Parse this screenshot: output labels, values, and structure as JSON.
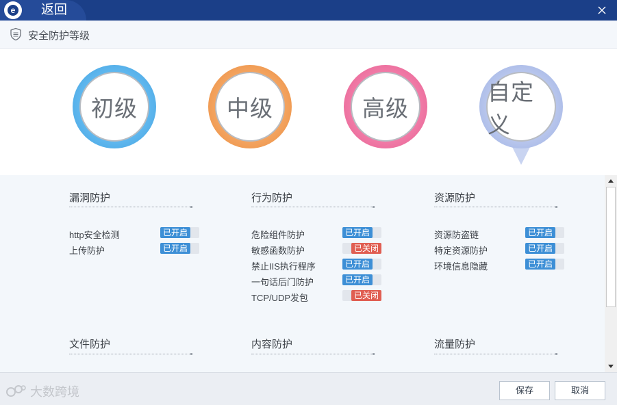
{
  "titlebar": {
    "logo_letter": "e",
    "back_label": "返回",
    "bg_color": "#1b3f88"
  },
  "header": {
    "title": "安全防护等级"
  },
  "levels": [
    {
      "label": "初级",
      "color": "#4aa8e6"
    },
    {
      "label": "中级",
      "color": "#ee9346"
    },
    {
      "label": "高级",
      "color": "#ea6497"
    },
    {
      "label": "自定义",
      "color": "#a9b9e7",
      "selected": true
    }
  ],
  "sections": [
    {
      "title": "漏洞防护",
      "items": [
        {
          "label": "http安全检测",
          "status": "已开启",
          "on": true
        },
        {
          "label": "上传防护",
          "status": "已开启",
          "on": true
        }
      ]
    },
    {
      "title": "行为防护",
      "items": [
        {
          "label": "危险组件防护",
          "status": "已开启",
          "on": true
        },
        {
          "label": "敏感函数防护",
          "status": "已关闭",
          "on": false
        },
        {
          "label": "禁止IIS执行程序",
          "status": "已开启",
          "on": true
        },
        {
          "label": "一句话后门防护",
          "status": "已开启",
          "on": true
        },
        {
          "label": "TCP/UDP发包",
          "status": "已关闭",
          "on": false
        }
      ]
    },
    {
      "title": "资源防护",
      "items": [
        {
          "label": "资源防盗链",
          "status": "已开启",
          "on": true
        },
        {
          "label": "特定资源防护",
          "status": "已开启",
          "on": true
        },
        {
          "label": "环境信息隐藏",
          "status": "已开启",
          "on": true
        }
      ]
    },
    {
      "title": "文件防护",
      "items": []
    },
    {
      "title": "内容防护",
      "items": []
    },
    {
      "title": "流量防护",
      "items": []
    }
  ],
  "footer": {
    "watermark": "大数跨境",
    "save_label": "保存",
    "cancel_label": "取消"
  },
  "colors": {
    "toggle_on": "#3d8fd6",
    "toggle_off": "#e05e52"
  }
}
